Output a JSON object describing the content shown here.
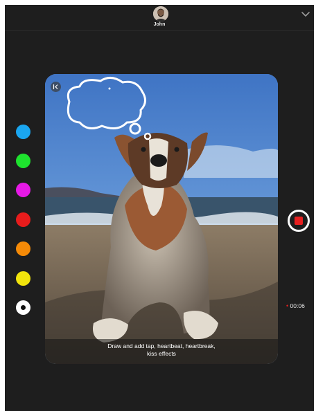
{
  "header": {
    "contact_name": "John"
  },
  "palette": {
    "colors": [
      "#1aa6f0",
      "#1ee32e",
      "#e619e6",
      "#e81c1c",
      "#f58a07",
      "#f2e40c",
      "#ffffff"
    ],
    "selected_index": 6
  },
  "canvas": {
    "caption_line1": "Draw and add tap, heartbeat, heartbreak,",
    "caption_line2": "kiss effects"
  },
  "recording": {
    "timer": "00:06",
    "dot": "•"
  },
  "icons": {
    "avatar": "user-avatar",
    "collapse": "chevron-down-icon",
    "exit": "exit-canvas-icon",
    "record": "stop-record-icon"
  }
}
